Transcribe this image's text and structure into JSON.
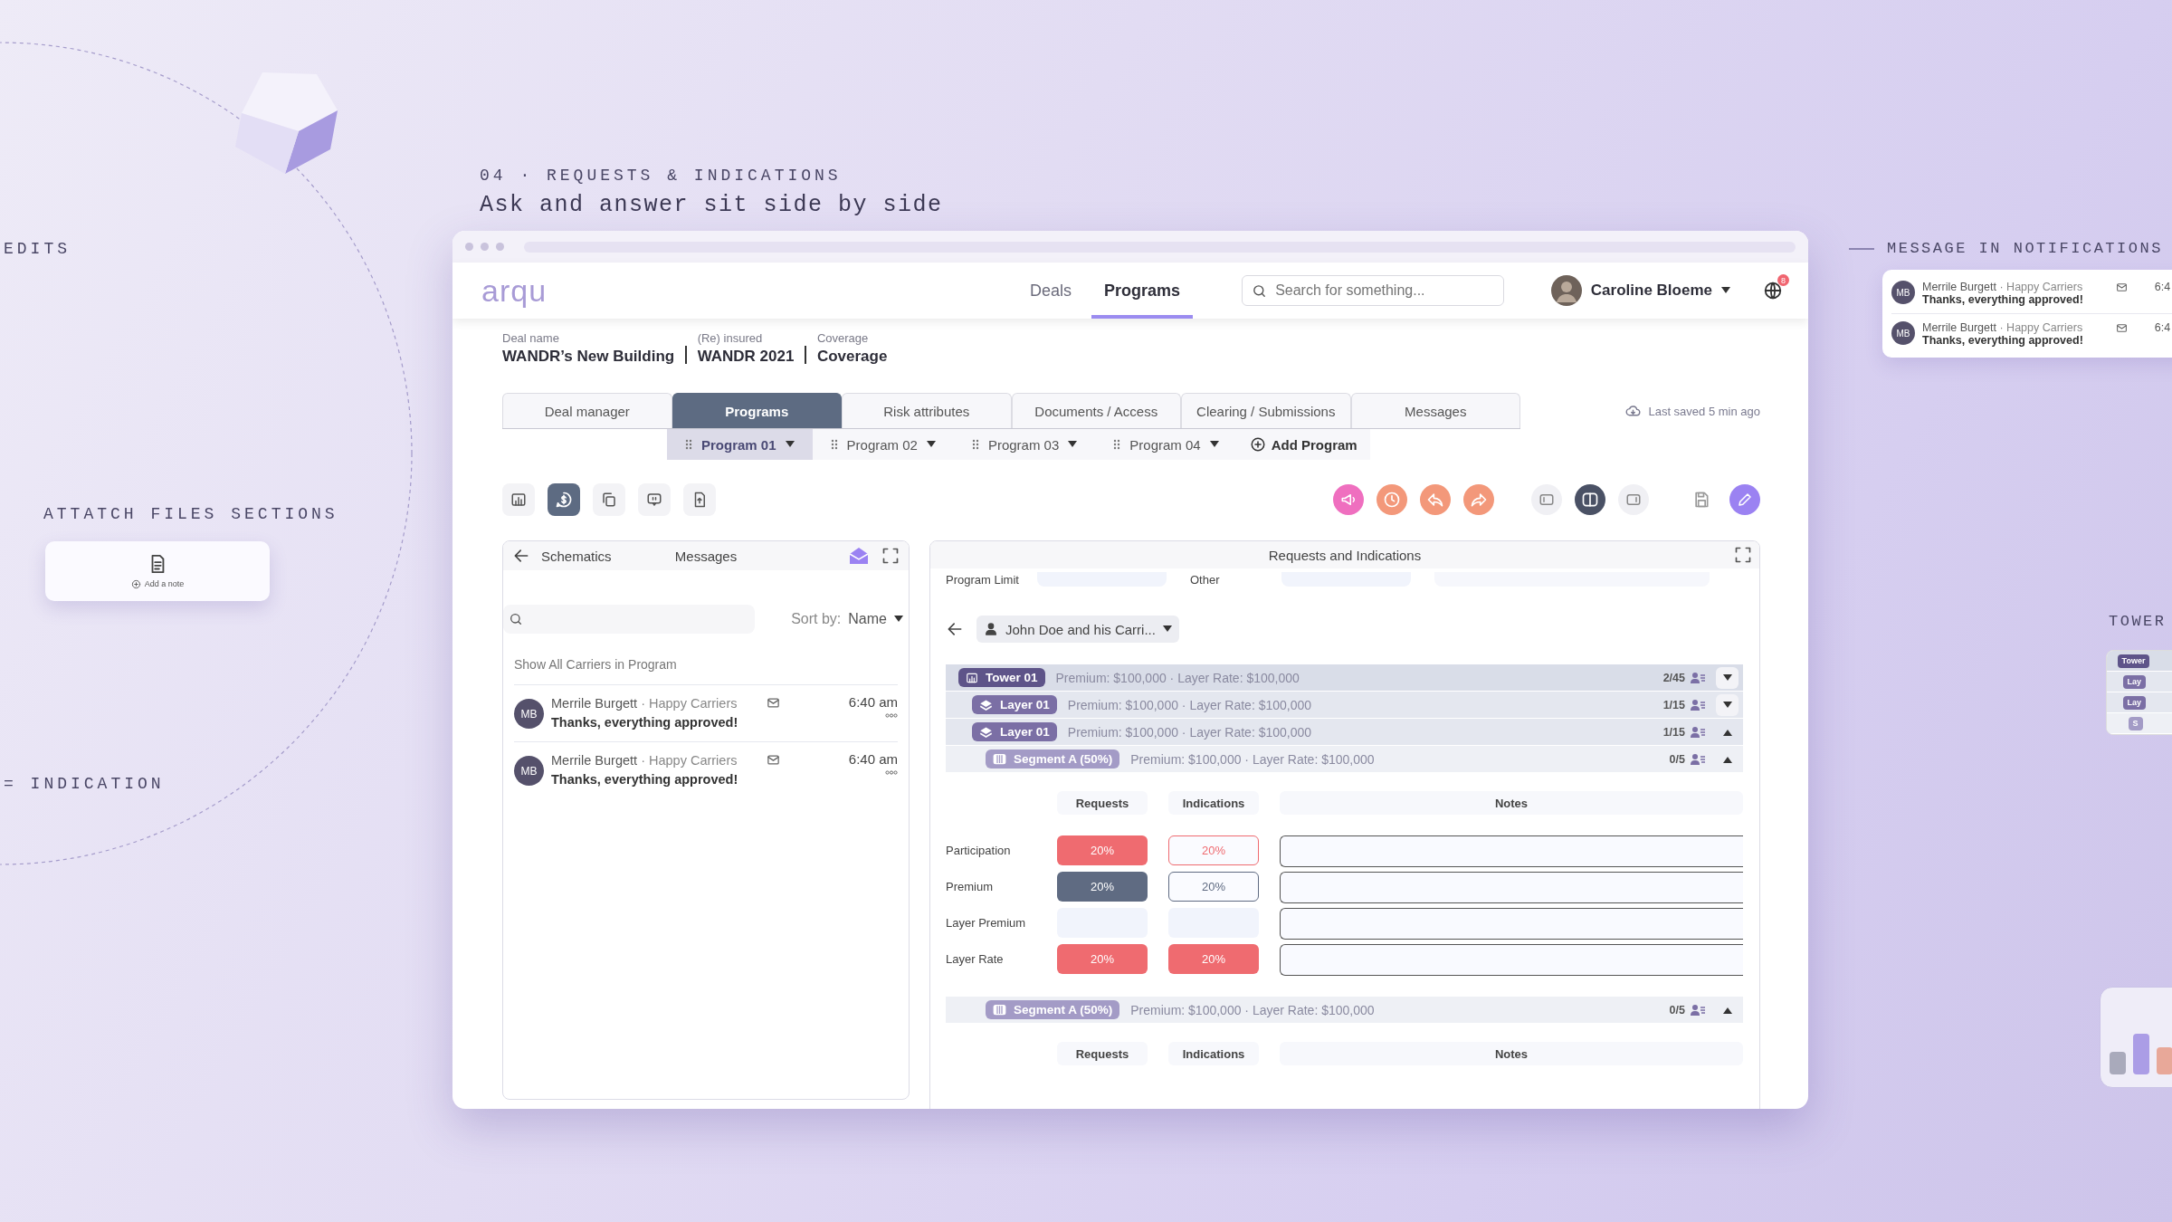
{
  "annotations": {
    "section_label": "04 · REQUESTS & INDICATIONS",
    "headline": "Ask and answer sit side by side",
    "edits_label": "EDITS",
    "attach_label": "ATTATCH FILES SECTIONS",
    "note_action": "Add a note",
    "indication_label": "= INDICATION",
    "notifications_label": "MESSAGE IN NOTIFICATIONS",
    "tower_label": "TOWER"
  },
  "notifications": [
    {
      "initials": "MB",
      "sender": "Merrile Burgett",
      "company": "· Happy Carriers",
      "message": "Thanks, everything approved!",
      "time": "6:4"
    },
    {
      "initials": "MB",
      "sender": "Merrile Burgett",
      "company": "· Happy Carriers",
      "message": "Thanks, everything approved!",
      "time": "6:4"
    }
  ],
  "tower_preview": [
    {
      "kind": "tower",
      "label": "Tower"
    },
    {
      "kind": "layer",
      "label": "Lay"
    },
    {
      "kind": "layer",
      "label": "Lay"
    },
    {
      "kind": "segment",
      "label": "S"
    }
  ],
  "window": {
    "logo": "arqu",
    "nav": [
      {
        "label": "Deals",
        "selected": false
      },
      {
        "label": "Programs",
        "selected": true
      }
    ],
    "search": {
      "placeholder": "Search for something..."
    },
    "user": {
      "name": "Caroline Bloeme"
    },
    "notification_badge": "8",
    "deal": [
      {
        "label": "Deal name",
        "value": "WANDR’s New Building"
      },
      {
        "label": "(Re) insured",
        "value": "WANDR 2021"
      },
      {
        "label": "Coverage",
        "value": "Coverage"
      }
    ],
    "tabs": [
      {
        "label": "Deal manager",
        "selected": false
      },
      {
        "label": "Programs",
        "selected": true
      },
      {
        "label": "Risk attributes",
        "selected": false
      },
      {
        "label": "Documents / Access",
        "selected": false
      },
      {
        "label": "Clearing / Submissions",
        "selected": false
      },
      {
        "label": "Messages",
        "selected": false
      }
    ],
    "last_saved": "Last saved 5 min ago",
    "programs": [
      {
        "label": "Program 01",
        "selected": true
      },
      {
        "label": "Program 02",
        "selected": false
      },
      {
        "label": "Program 03",
        "selected": false
      },
      {
        "label": "Program 04",
        "selected": false
      }
    ],
    "add_program": "Add Program",
    "view_tools": [
      {
        "kind": "tower",
        "selected": false
      },
      {
        "kind": "dollar",
        "selected": true
      },
      {
        "kind": "copy",
        "selected": false
      },
      {
        "kind": "chat",
        "selected": false
      },
      {
        "kind": "file",
        "selected": false
      }
    ],
    "actions": [
      {
        "kind": "megaphone",
        "color": "#ef6fbf"
      },
      {
        "kind": "clock",
        "color": "#f3987a"
      },
      {
        "kind": "reply",
        "color": "#f3987a"
      },
      {
        "kind": "forward",
        "color": "#f3987a"
      }
    ],
    "layouts": [
      {
        "kind": "left",
        "selected": false
      },
      {
        "kind": "split",
        "selected": true
      },
      {
        "kind": "right",
        "selected": false
      }
    ],
    "messages_panel": {
      "back_label": "Schematics",
      "title": "Messages",
      "sort_label": "Sort by:",
      "sort_value": "Name",
      "show_all": "Show All Carriers in Program",
      "messages": [
        {
          "initials": "MB",
          "sender": "Merrile Burgett",
          "company": "· Happy Carriers",
          "message": "Thanks, everything approved!",
          "time": "6:40 am"
        },
        {
          "initials": "MB",
          "sender": "Merrile Burgett",
          "company": "· Happy Carriers",
          "message": "Thanks, everything approved!",
          "time": "6:40 am"
        }
      ]
    },
    "requests_panel": {
      "title": "Requests and Indications",
      "fields": [
        {
          "label": "Program Limit"
        },
        {
          "label": "Other"
        }
      ],
      "carrier": "John Doe and his Carri...",
      "tree": [
        {
          "kind": "tower",
          "label": "Tower 01",
          "details": "Premium: $100,000 · Layer Rate: $100,000",
          "count": "2/45",
          "expanded": false,
          "children": [
            {
              "kind": "layer",
              "label": "Layer 01",
              "details": "Premium: $100,000 · Layer Rate: $100,000",
              "count": "1/15",
              "expanded": false
            },
            {
              "kind": "layer",
              "label": "Layer 01",
              "details": "Premium: $100,000 · Layer Rate: $100,000",
              "count": "1/15",
              "expanded": true,
              "children": [
                {
                  "kind": "segment",
                  "label": "Segment A (50%)",
                  "details": "Premium: $100,000 · Layer Rate: $100,000",
                  "count": "0/5",
                  "expanded": true,
                  "grid": {
                    "columns": [
                      "Requests",
                      "Indications",
                      "Notes"
                    ],
                    "rows": [
                      {
                        "label": "Participation",
                        "request": {
                          "kind": "solid",
                          "color": "#ef6b70",
                          "value": "20%"
                        },
                        "indication": {
                          "kind": "outline",
                          "color": "#ef6b70",
                          "value": "20%"
                        }
                      },
                      {
                        "label": "Premium",
                        "request": {
                          "kind": "solid",
                          "color": "#5f6b82",
                          "value": "20%"
                        },
                        "indication": {
                          "kind": "outline",
                          "color": "#5f6b82",
                          "value": "20%"
                        }
                      },
                      {
                        "label": "Layer Premium",
                        "request": {
                          "kind": "empty"
                        },
                        "indication": {
                          "kind": "empty"
                        }
                      },
                      {
                        "label": "Layer Rate",
                        "request": {
                          "kind": "solid",
                          "color": "#ef6b70",
                          "value": "20%"
                        },
                        "indication": {
                          "kind": "solid",
                          "color": "#ef6b70",
                          "value": "20%"
                        }
                      }
                    ]
                  }
                },
                {
                  "kind": "segment",
                  "label": "Segment A (50%)",
                  "details": "Premium: $100,000 · Layer Rate: $100,000",
                  "count": "0/5",
                  "expanded": true,
                  "grid": {
                    "columns": [
                      "Requests",
                      "Indications",
                      "Notes"
                    ]
                  }
                }
              ]
            }
          ]
        }
      ]
    }
  }
}
